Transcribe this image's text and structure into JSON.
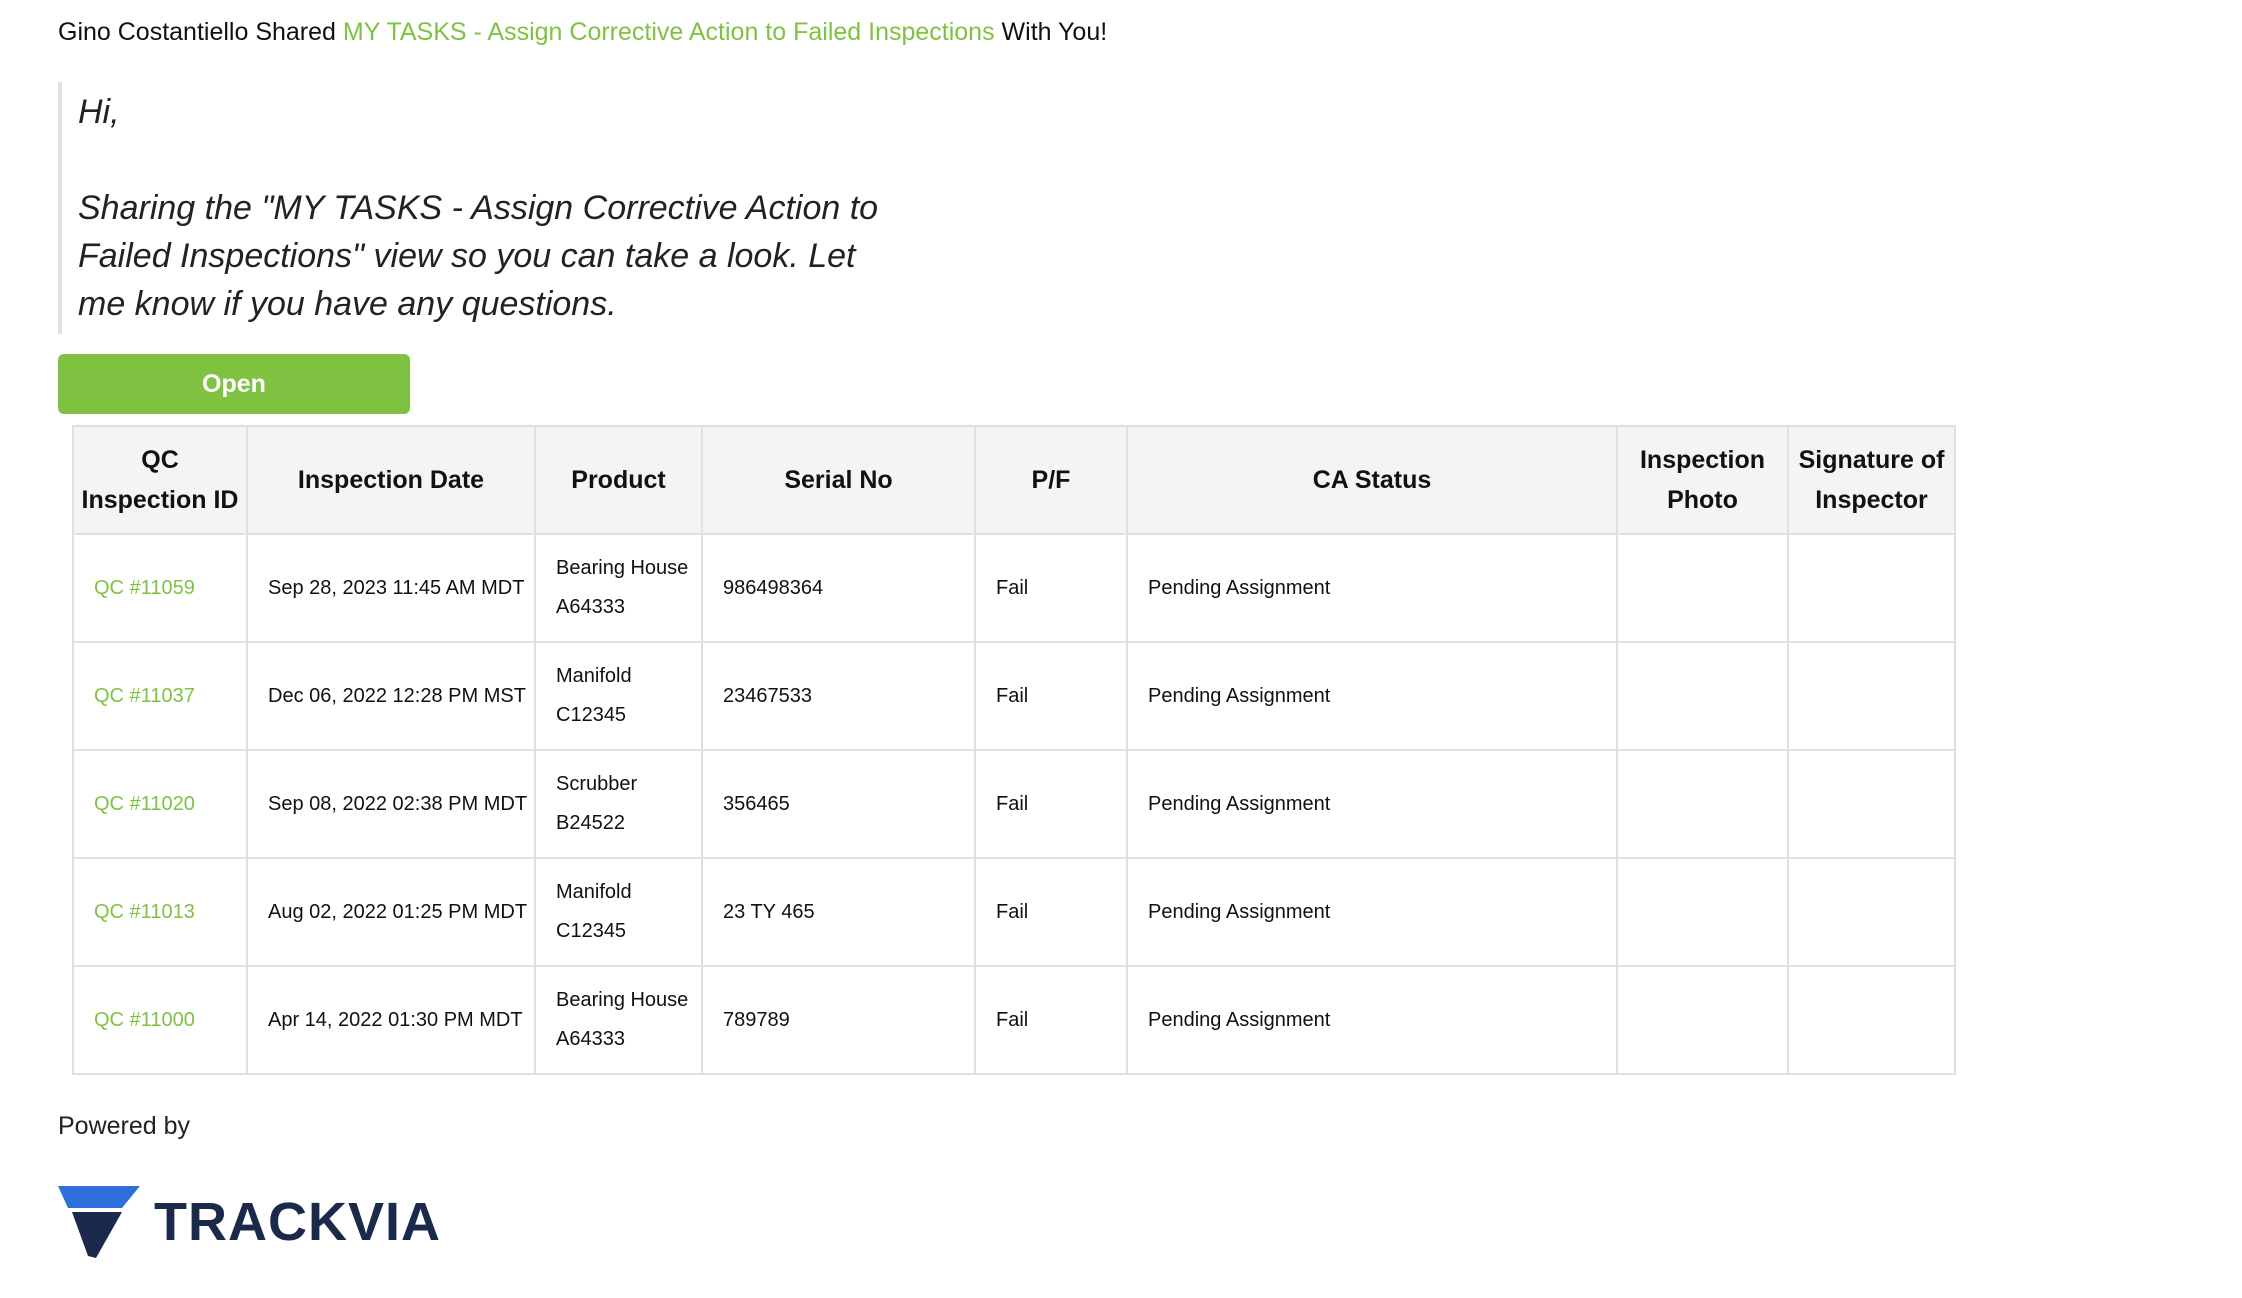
{
  "header": {
    "sharer": "Gino Costantiello Shared",
    "view_link": "MY TASKS - Assign Corrective Action to Failed Inspections",
    "suffix": "With You!"
  },
  "message": {
    "greeting": "Hi,",
    "body": "Sharing the \"MY TASKS - Assign Corrective Action to Failed Inspections\" view so you can take a look. Let me know if you have any questions."
  },
  "open_button": {
    "label": "Open"
  },
  "table": {
    "headers": {
      "qc_id": "QC Inspection ID",
      "date": "Inspection Date",
      "product": "Product",
      "serial": "Serial No",
      "pf": "P/F",
      "ca_status": "CA Status",
      "photo": "Inspection Photo",
      "signature": "Signature of Inspector"
    },
    "rows": [
      {
        "qc_id": "QC #11059",
        "date": "Sep 28, 2023 11:45 AM MDT",
        "product_name": "Bearing House",
        "product_code": "A64333",
        "serial": "986498364",
        "pf": "Fail",
        "ca_status": "Pending Assignment",
        "photo": "",
        "signature": ""
      },
      {
        "qc_id": "QC #11037",
        "date": "Dec 06, 2022 12:28 PM MST",
        "product_name": "Manifold",
        "product_code": "C12345",
        "serial": "23467533",
        "pf": "Fail",
        "ca_status": "Pending Assignment",
        "photo": "",
        "signature": ""
      },
      {
        "qc_id": "QC #11020",
        "date": "Sep 08, 2022 02:38 PM MDT",
        "product_name": "Scrubber",
        "product_code": "B24522",
        "serial": "356465",
        "pf": "Fail",
        "ca_status": "Pending Assignment",
        "photo": "",
        "signature": ""
      },
      {
        "qc_id": "QC #11013",
        "date": "Aug 02, 2022 01:25 PM MDT",
        "product_name": "Manifold",
        "product_code": "C12345",
        "serial": "23 TY 465",
        "pf": "Fail",
        "ca_status": "Pending Assignment",
        "photo": "",
        "signature": ""
      },
      {
        "qc_id": "QC #11000",
        "date": "Apr 14, 2022 01:30 PM MDT",
        "product_name": "Bearing House",
        "product_code": "A64333",
        "serial": "789789",
        "pf": "Fail",
        "ca_status": "Pending Assignment",
        "photo": "",
        "signature": ""
      }
    ]
  },
  "footer": {
    "powered_by": "Powered by",
    "logo_text": "TRACKVIA",
    "logo_icon": "trackvia-logo-icon"
  },
  "colors": {
    "accent": "#7fc241",
    "logo_navy": "#1b2a4a",
    "logo_blue": "#2f6fdb"
  }
}
